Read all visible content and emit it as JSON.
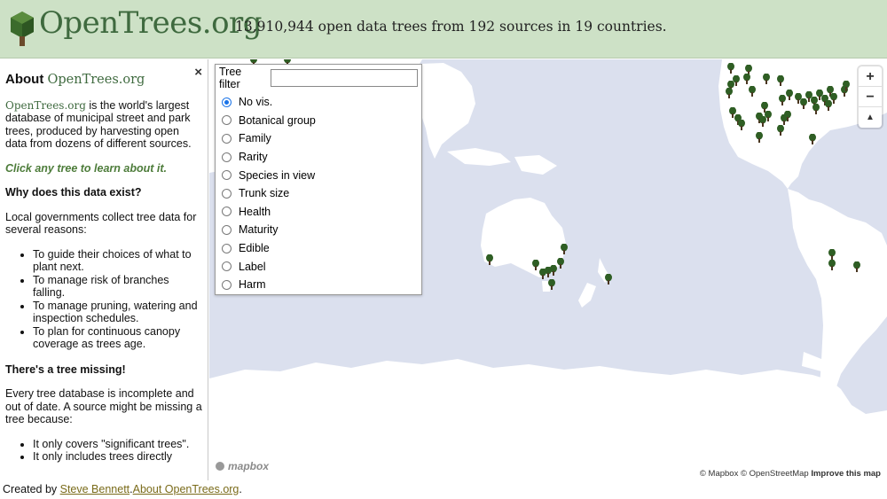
{
  "header": {
    "logo_text": "OpenTrees.org",
    "tagline": "13,910,944 open data trees from 192 sources in 19 countries."
  },
  "sidebar": {
    "close_symbol": "×",
    "about_prefix": "About ",
    "about_brand": "OpenTrees.org",
    "intro_brand": "OpenTrees.org",
    "intro_text": " is the world's largest database of municipal street and park trees, produced by harvesting open data from dozens of different sources.",
    "cta": "Click any tree to learn about it.",
    "why_heading": "Why does this data exist?",
    "why_text": "Local governments collect tree data for several reasons:",
    "reasons": [
      "To guide their choices of what to plant next.",
      "To manage risk of branches falling.",
      "To manage pruning, watering and inspection schedules.",
      "To plan for continuous canopy coverage as trees age."
    ],
    "missing_heading": "There's a tree missing!",
    "missing_text": "Every tree database is incomplete and out of date. A source might be missing a tree because:",
    "missing_reasons": [
      "It only covers \"significant trees\".",
      "It only includes trees directly"
    ]
  },
  "filter": {
    "label": "Tree filter",
    "input_value": "",
    "options": [
      "No vis.",
      "Botanical group",
      "Family",
      "Rarity",
      "Species in view",
      "Trunk size",
      "Health",
      "Maturity",
      "Edible",
      "Label",
      "Harm"
    ],
    "selected": "No vis."
  },
  "map": {
    "zoom_in": "+",
    "zoom_out": "−",
    "compass": "▲",
    "mapbox_logo": "mapbox",
    "attribution": "© Mapbox © OpenStreetMap",
    "improve": "Improve this map"
  },
  "footer": {
    "prefix": "Created by ",
    "author": "Steve Bennett",
    "about_link": "About OpenTrees.org",
    "suffix": "."
  },
  "colors": {
    "header_bg": "#cde1c6",
    "brand_green": "#3f6a3f",
    "ocean": "#dbe0ee",
    "land": "#ffffff",
    "tree": "#2f5e24",
    "link": "#7a6b1a"
  }
}
